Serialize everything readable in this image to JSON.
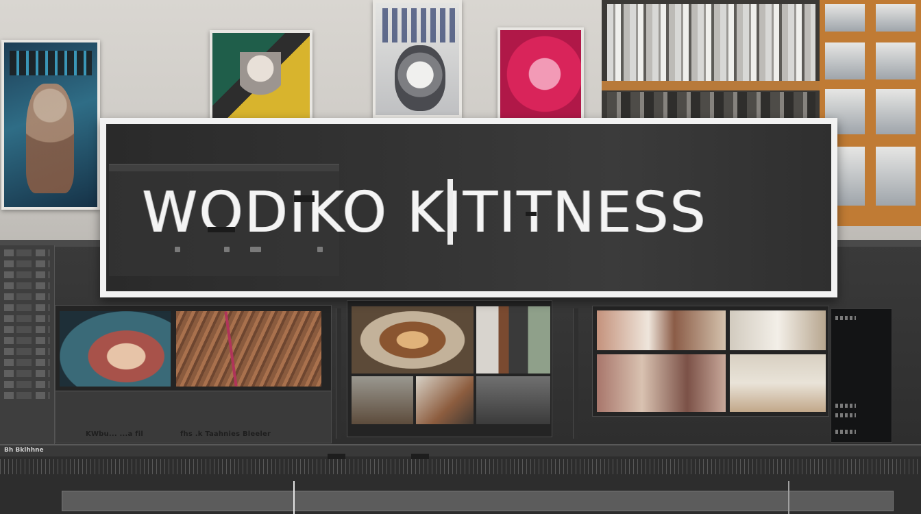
{
  "title_card": {
    "text": "WODIKO KITITNESS"
  },
  "monitor_a": {
    "caption_left": "KWbu...  ...a  fil",
    "caption_right": "fhs   .k  Taahnies  Bleeler"
  },
  "timeline": {
    "label": "Bh Bklhhne"
  },
  "colors": {
    "frame": "#f2f2f2",
    "card_bg": "#333333",
    "accent_magenta": "#d9245a",
    "shelf_wood": "#b87a3a"
  }
}
